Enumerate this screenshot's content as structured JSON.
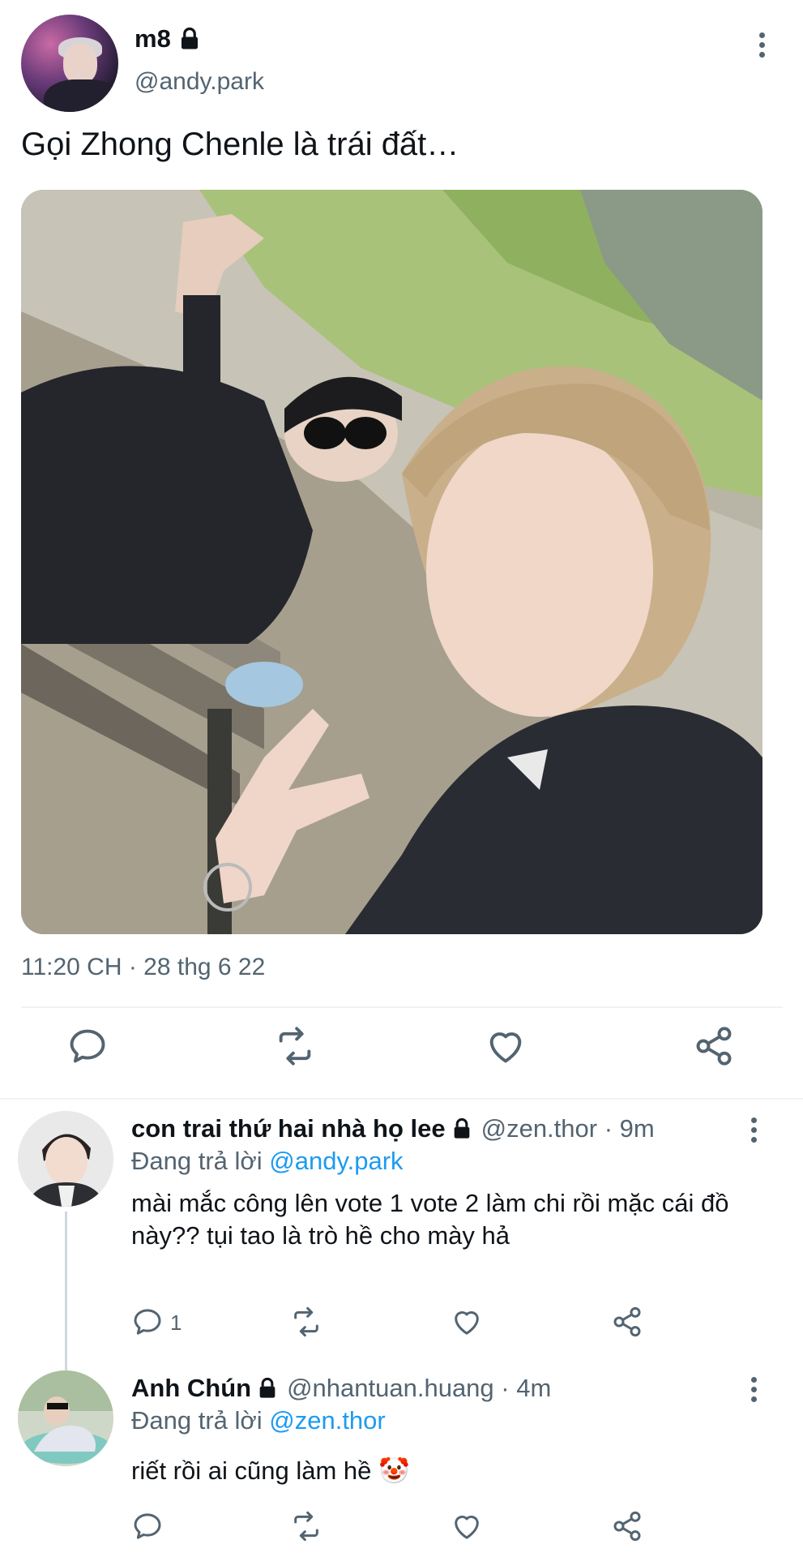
{
  "tweet": {
    "author_name": "m8",
    "author_handle": "@andy.park",
    "text": "Gọi Zhong Chenle là trái đất…",
    "timestamp": "11:20 CH · 28 thg 6 22"
  },
  "actions": {
    "reply_icon": "comment-icon",
    "retweet_icon": "retweet-icon",
    "like_icon": "heart-icon",
    "share_icon": "share-icon"
  },
  "replies": [
    {
      "name": "con trai thứ hai nhà họ lee",
      "handle": "@zen.thor",
      "time": "9m",
      "replying_prefix": "Đang trả lời",
      "replying_to": "@andy.park",
      "text": "mài mắc công lên vote 1 vote 2 làm chi rồi mặc cái đồ này?? tụi tao là trò hề cho mày hả",
      "reply_count": "1"
    },
    {
      "name": "Anh Chún",
      "handle": "@nhantuan.huang",
      "time": "4m",
      "replying_prefix": "Đang trả lời",
      "replying_to": "@zen.thor",
      "text": "riết rồi ai cũng làm hề 🤡",
      "reply_count": ""
    }
  ],
  "colors": {
    "accent": "#1d9bf0",
    "muted": "#536471",
    "text": "#0f1419"
  }
}
